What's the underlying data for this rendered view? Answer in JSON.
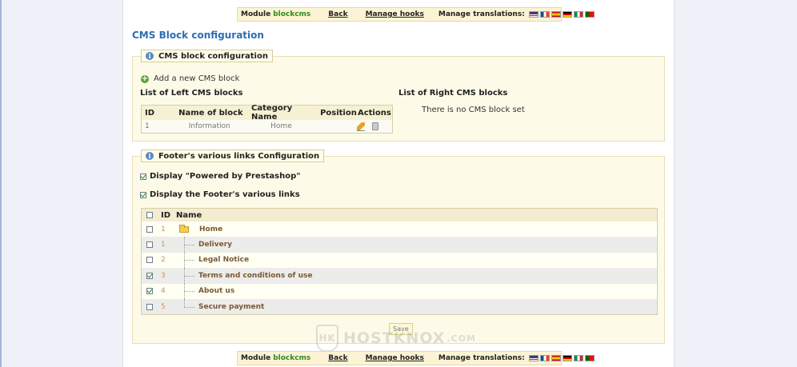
{
  "toolbar": {
    "module_label": "Module",
    "module_name": "blockcms",
    "back": "Back",
    "manage_hooks": "Manage hooks",
    "manage_translations": "Manage translations:",
    "flags": [
      "us-flag",
      "fr-flag",
      "es-flag",
      "de-flag",
      "it-flag",
      "pt-flag"
    ]
  },
  "page_title": "CMS Block configuration",
  "cms_section": {
    "legend": "CMS block configuration",
    "add_link": "Add a new CMS block",
    "left_title": "List of Left CMS blocks",
    "right_title": "List of Right CMS blocks",
    "right_empty": "There is no CMS block set",
    "table": {
      "headers": [
        "ID",
        "Name of block",
        "Category Name",
        "Position",
        "Actions"
      ],
      "rows": [
        {
          "id": "1",
          "name": "Information",
          "category": "Home",
          "position": "",
          "actions": [
            "edit-icon",
            "delete-icon"
          ]
        }
      ]
    }
  },
  "footer_section": {
    "legend": "Footer's various links Configuration",
    "powered_by": {
      "label": "Display \"Powered by Prestashop\"",
      "checked": true
    },
    "display_links": {
      "label": "Display the Footer's various links",
      "checked": true
    },
    "table": {
      "headers": [
        "",
        "ID",
        "Name"
      ],
      "rows": [
        {
          "id": "1",
          "name": "Home",
          "checked": false,
          "folder": true
        },
        {
          "id": "1",
          "name": "Delivery",
          "checked": false,
          "folder": false
        },
        {
          "id": "2",
          "name": "Legal Notice",
          "checked": false,
          "folder": false
        },
        {
          "id": "3",
          "name": "Terms and conditions of use",
          "checked": true,
          "folder": false
        },
        {
          "id": "4",
          "name": "About us",
          "checked": true,
          "folder": false
        },
        {
          "id": "5",
          "name": "Secure payment",
          "checked": false,
          "folder": false
        }
      ]
    },
    "save": "Save"
  },
  "watermark": {
    "text": "HOSTKNOX",
    "domain": ".COM",
    "badge": "HK"
  },
  "colors": {
    "title": "#2e6db4",
    "module_name": "#2e8b1e",
    "panel_bg": "#fdfbe8",
    "row_text": "#7b5a32"
  }
}
